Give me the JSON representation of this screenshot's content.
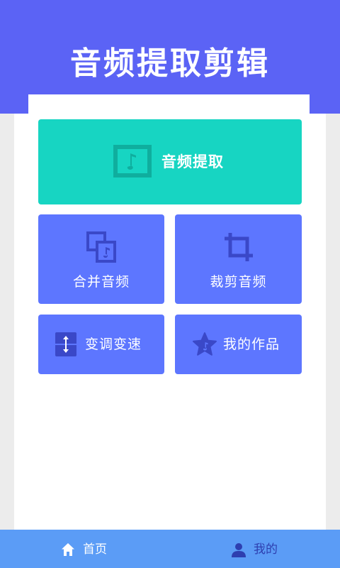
{
  "header": {
    "title": "音频提取剪辑"
  },
  "main": {
    "extract": {
      "label": "音频提取",
      "icon": "music-note-frame-icon"
    },
    "merge": {
      "label": "合并音频",
      "icon": "merge-music-icon"
    },
    "trim": {
      "label": "裁剪音频",
      "icon": "crop-icon"
    },
    "pitch_speed": {
      "label": "变调变速",
      "icon": "vertical-arrows-icon"
    },
    "my_works": {
      "label": "我的作品",
      "icon": "star-music-icon"
    }
  },
  "tabbar": {
    "home": {
      "label": "首页",
      "icon": "home-icon"
    },
    "mine": {
      "label": "我的",
      "icon": "person-icon"
    }
  },
  "colors": {
    "header": "#5b63f5",
    "extract_button": "#17d5c2",
    "tile": "#5d76ff",
    "tabbar": "#5b9cf6",
    "icon_dark": "#3a48c8",
    "inactive_tab": "#2e3fb0"
  }
}
